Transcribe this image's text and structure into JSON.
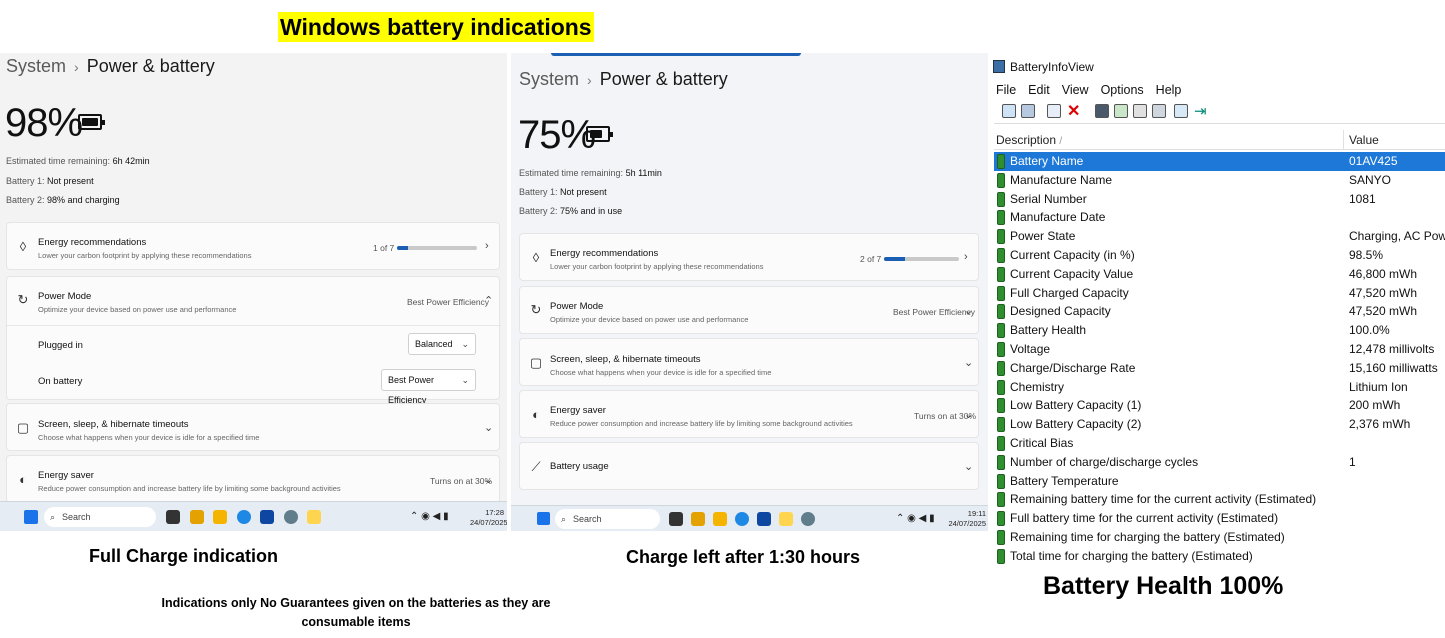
{
  "title": "Windows battery indications",
  "left_panel": {
    "breadcrumb_system": "System",
    "breadcrumb_page": "Power & battery",
    "percent": "98%",
    "battery_fill_fraction": 0.98,
    "est_label": "Estimated time remaining:",
    "est_value": "6h 42min",
    "b1_label": "Battery 1:",
    "b1_value": "Not present",
    "b2_label": "Battery 2:",
    "b2_value": "98% and charging",
    "energy_rec_title": "Energy recommendations",
    "energy_rec_sub": "Lower your carbon footprint by applying these recommendations",
    "energy_rec_count": "1 of 7",
    "energy_rec_progress": 0.14,
    "power_mode_title": "Power Mode",
    "power_mode_sub": "Optimize your device based on power use and performance",
    "power_mode_value": "Best Power Efficiency",
    "plugged_in_label": "Plugged in",
    "plugged_in_value": "Balanced",
    "on_battery_label": "On battery",
    "on_battery_value": "Best Power Efficiency",
    "screen_title": "Screen, sleep, & hibernate timeouts",
    "screen_sub": "Choose what happens when your device is idle for a specified time",
    "saver_title": "Energy saver",
    "saver_sub": "Reduce power consumption and increase battery life by limiting some background activities",
    "saver_value": "Turns on at 30%",
    "search_label": "Search",
    "time": "17:28",
    "date": "24/07/2025"
  },
  "middle_panel": {
    "breadcrumb_system": "System",
    "breadcrumb_page": "Power & battery",
    "percent": "75%",
    "battery_fill_fraction": 0.75,
    "est_label": "Estimated time remaining:",
    "est_value": "5h 11min",
    "b1_label": "Battery 1:",
    "b1_value": "Not present",
    "b2_label": "Battery 2:",
    "b2_value": "75% and in use",
    "energy_rec_title": "Energy recommendations",
    "energy_rec_sub": "Lower your carbon footprint by applying these recommendations",
    "energy_rec_count": "2 of 7",
    "energy_rec_progress": 0.28,
    "power_mode_title": "Power Mode",
    "power_mode_sub": "Optimize your device based on power use and performance",
    "power_mode_value": "Best Power Efficiency",
    "screen_title": "Screen, sleep, & hibernate timeouts",
    "screen_sub": "Choose what happens when your device is idle for a specified time",
    "saver_title": "Energy saver",
    "saver_sub": "Reduce power consumption and increase battery life by limiting some background activities",
    "saver_value": "Turns on at 30%",
    "usage_title": "Battery usage",
    "search_label": "Search",
    "time": "19:11",
    "date": "24/07/2025"
  },
  "battery_info_view": {
    "window_title": "BatteryInfoView",
    "menu": [
      "File",
      "Edit",
      "View",
      "Options",
      "Help"
    ],
    "col_description": "Description",
    "col_value": "Value",
    "rows": [
      {
        "d": "Battery Name",
        "v": "01AV425"
      },
      {
        "d": "Manufacture Name",
        "v": "SANYO"
      },
      {
        "d": "Serial Number",
        "v": "1081"
      },
      {
        "d": "Manufacture Date",
        "v": ""
      },
      {
        "d": "Power State",
        "v": "Charging, AC Power"
      },
      {
        "d": "Current Capacity (in %)",
        "v": "98.5%"
      },
      {
        "d": "Current Capacity Value",
        "v": "46,800 mWh"
      },
      {
        "d": "Full Charged Capacity",
        "v": "47,520 mWh"
      },
      {
        "d": "Designed Capacity",
        "v": "47,520 mWh"
      },
      {
        "d": "Battery Health",
        "v": "100.0%"
      },
      {
        "d": "Voltage",
        "v": "12,478 millivolts"
      },
      {
        "d": "Charge/Discharge Rate",
        "v": "15,160 milliwatts"
      },
      {
        "d": "Chemistry",
        "v": "Lithium Ion"
      },
      {
        "d": "Low Battery Capacity (1)",
        "v": "200 mWh"
      },
      {
        "d": "Low Battery Capacity (2)",
        "v": "2,376 mWh"
      },
      {
        "d": "Critical Bias",
        "v": ""
      },
      {
        "d": "Number of charge/discharge cycles",
        "v": "1"
      },
      {
        "d": "Battery Temperature",
        "v": ""
      },
      {
        "d": "Remaining battery time for the current activity (Estimated)",
        "v": ""
      },
      {
        "d": "Full battery time for the current activity (Estimated)",
        "v": ""
      },
      {
        "d": "Remaining time for charging the battery (Estimated)",
        "v": ""
      },
      {
        "d": "Total  time for charging the battery (Estimated)",
        "v": ""
      }
    ]
  },
  "captions": {
    "full_charge": "Full Charge indication",
    "charge_left": "Charge left after 1:30 hours",
    "health": "Battery Health 100%",
    "disclaimer_line1": "Indications only No Guarantees given on the batteries as they are",
    "disclaimer_line2": "consumable items"
  },
  "colors": {
    "title_highlight": "#ffff00",
    "selection": "#1e78d7",
    "battery_green": "#2f8f2f",
    "progress_blue": "#1a5fb4"
  }
}
